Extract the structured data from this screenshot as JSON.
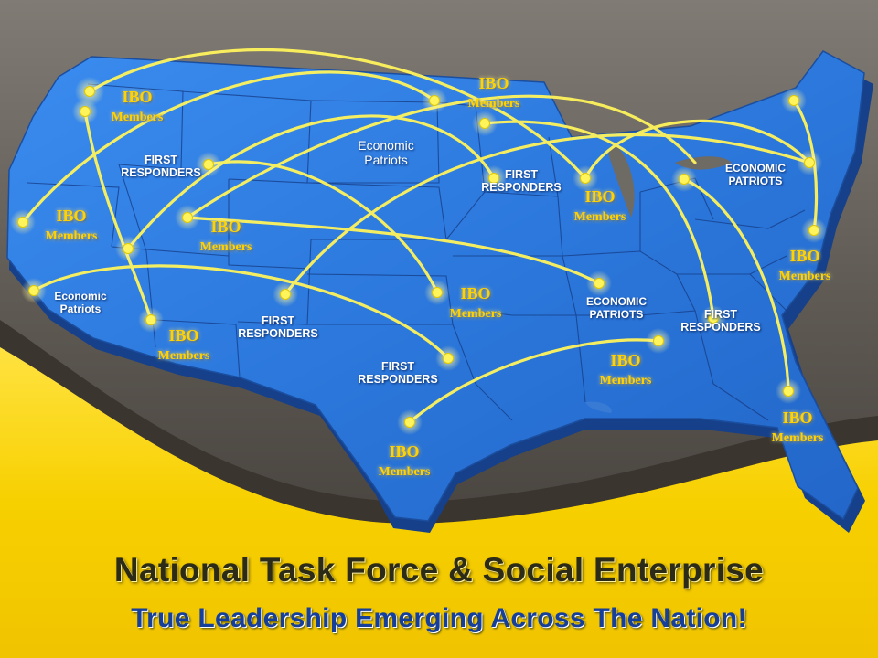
{
  "colors": {
    "background_top": "#6e6a64",
    "background_bottom": "#f5d400",
    "map_fill": "#2f7ee0",
    "map_edge": "#1a4a9a",
    "line_color": "#fff45c",
    "label_gold": "#ffd200"
  },
  "labels": {
    "ibo_nw": {
      "line1": "IBO",
      "line2": "Members"
    },
    "ibo_mn": {
      "line1": "IBO",
      "line2": "Members"
    },
    "ibo_ca": {
      "line1": "IBO",
      "line2": "Members"
    },
    "ibo_id": {
      "line1": "IBO",
      "line2": "Members"
    },
    "ibo_wi": {
      "line1": "IBO",
      "line2": "Members"
    },
    "ibo_ne": {
      "line1": "IBO",
      "line2": "Members"
    },
    "ibo_az": {
      "line1": "IBO",
      "line2": "Members"
    },
    "ibo_ok": {
      "line1": "IBO",
      "line2": "Members"
    },
    "ibo_ms": {
      "line1": "IBO",
      "line2": "Members"
    },
    "ibo_fl": {
      "line1": "IBO",
      "line2": "Members"
    },
    "ibo_tx": {
      "line1": "IBO",
      "line2": "Members"
    },
    "fr_mt": {
      "line1": "FIRST",
      "line2": "RESPONDERS"
    },
    "fr_ia": {
      "line1": "FIRST",
      "line2": "RESPONDERS"
    },
    "fr_nm": {
      "line1": "FIRST",
      "line2": "RESPONDERS"
    },
    "fr_tx": {
      "line1": "FIRST",
      "line2": "RESPONDERS"
    },
    "fr_ga": {
      "line1": "FIRST",
      "line2": "RESPONDERS"
    },
    "ep_nd": {
      "line1": "Economic",
      "line2": "Patriots"
    },
    "ep_ca": {
      "line1": "Economic",
      "line2": "Patriots"
    },
    "ep_tn": {
      "line1": "ECONOMIC",
      "line2": "PATRIOTS"
    },
    "ep_oh": {
      "line1": "ECONOMIC",
      "line2": "PATRIOTS"
    }
  },
  "headline": "National Task Force & Social Enterprise",
  "subline": "True Leadership Emerging Across The Nation!"
}
